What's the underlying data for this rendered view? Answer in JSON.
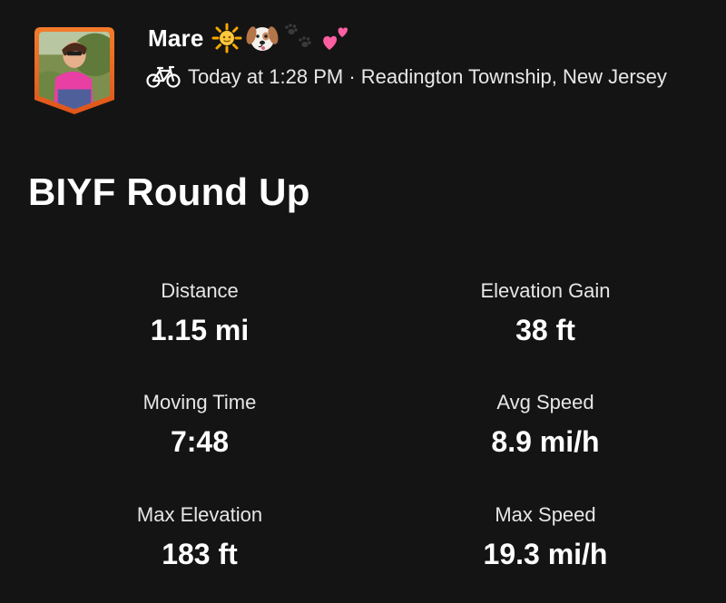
{
  "athlete": {
    "name": "Mare",
    "emoji_icons": [
      "sun-icon",
      "dog-face-icon",
      "paw-prints-icon",
      "two-hearts-icon"
    ]
  },
  "activity_meta": {
    "sport_icon": "bike-icon",
    "timestamp": "Today at 1:28 PM",
    "separator": " · ",
    "location": "Readington Township, New Jersey"
  },
  "activity": {
    "title": "BIYF Round Up"
  },
  "stats": {
    "distance": {
      "label": "Distance",
      "value": "1.15 mi"
    },
    "elevation_gain": {
      "label": "Elevation Gain",
      "value": "38 ft"
    },
    "moving_time": {
      "label": "Moving Time",
      "value": "7:48"
    },
    "avg_speed": {
      "label": "Avg Speed",
      "value": "8.9 mi/h"
    },
    "max_elevation": {
      "label": "Max Elevation",
      "value": "183 ft"
    },
    "max_speed": {
      "label": "Max Speed",
      "value": "19.3 mi/h"
    }
  },
  "colors": {
    "background": "#151414",
    "avatar_border": "#f26b1d",
    "text": "#ffffff"
  }
}
